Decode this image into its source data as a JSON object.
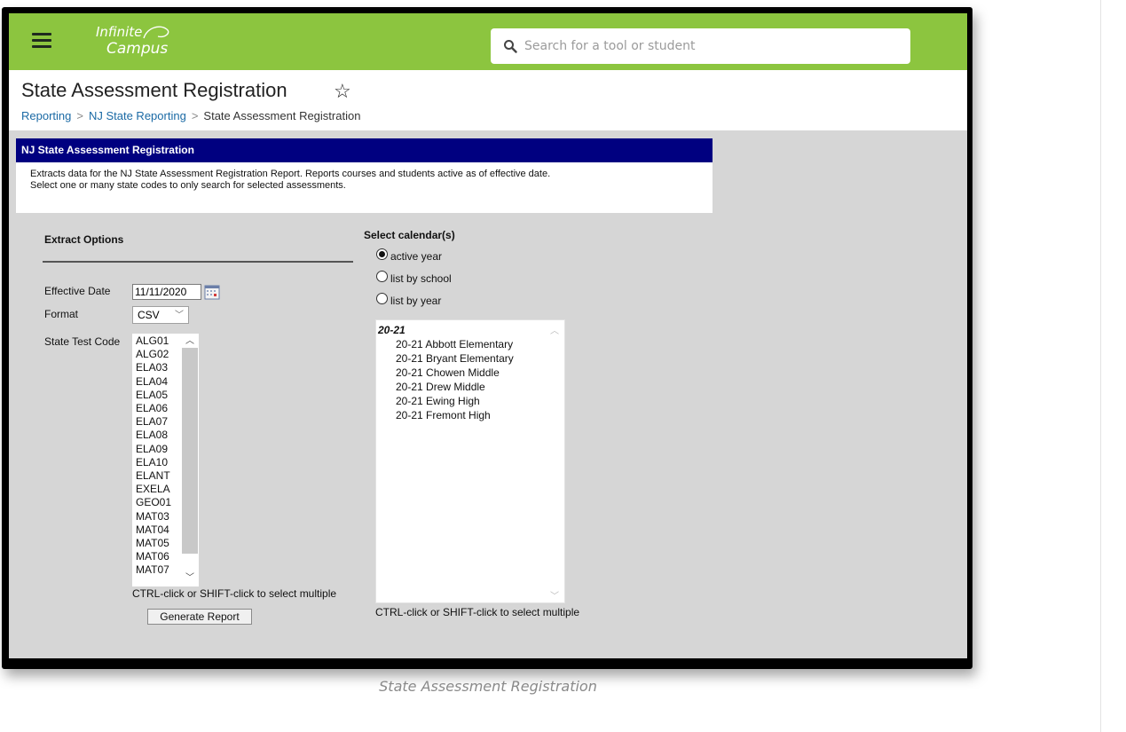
{
  "app": {
    "logo_line1": "Infinite",
    "logo_line2": "Campus",
    "search_placeholder": "Search for a tool or student"
  },
  "header": {
    "title": "State Assessment Registration",
    "breadcrumb": [
      "Reporting",
      "NJ State Reporting",
      "State Assessment Registration"
    ]
  },
  "panel": {
    "title": "NJ State Assessment Registration",
    "description_line1": "Extracts data for the NJ State Assessment Registration Report. Reports courses and students active as of effective date.",
    "description_line2": "Select one or many state codes to only search for selected assessments."
  },
  "extract_options": {
    "heading": "Extract Options",
    "effective_date_label": "Effective Date",
    "effective_date_value": "11/11/2020",
    "format_label": "Format",
    "format_value": "CSV",
    "state_test_code_label": "State Test Code",
    "state_test_codes": [
      "ALG01",
      "ALG02",
      "ELA03",
      "ELA04",
      "ELA05",
      "ELA06",
      "ELA07",
      "ELA08",
      "ELA09",
      "ELA10",
      "ELANT",
      "EXELA",
      "GEO01",
      "MAT03",
      "MAT04",
      "MAT05",
      "MAT06",
      "MAT07"
    ],
    "multi_select_hint": "CTRL-click or SHIFT-click to select multiple",
    "generate_button": "Generate Report"
  },
  "calendars": {
    "heading": "Select calendar(s)",
    "options": [
      "active year",
      "list by school",
      "list by year"
    ],
    "selected_option": "active year",
    "year_group": "20-21",
    "schools": [
      "20-21 Abbott Elementary",
      "20-21 Bryant Elementary",
      "20-21 Chowen Middle",
      "20-21 Drew Middle",
      "20-21 Ewing High",
      "20-21 Fremont High"
    ],
    "multi_select_hint": "CTRL-click or SHIFT-click to select multiple"
  },
  "caption": "State Assessment Registration",
  "colors": {
    "topbar": "#8cc53f",
    "panel_header": "#000080",
    "content_bg": "#d6d6d6",
    "link": "#1b6aa5"
  }
}
